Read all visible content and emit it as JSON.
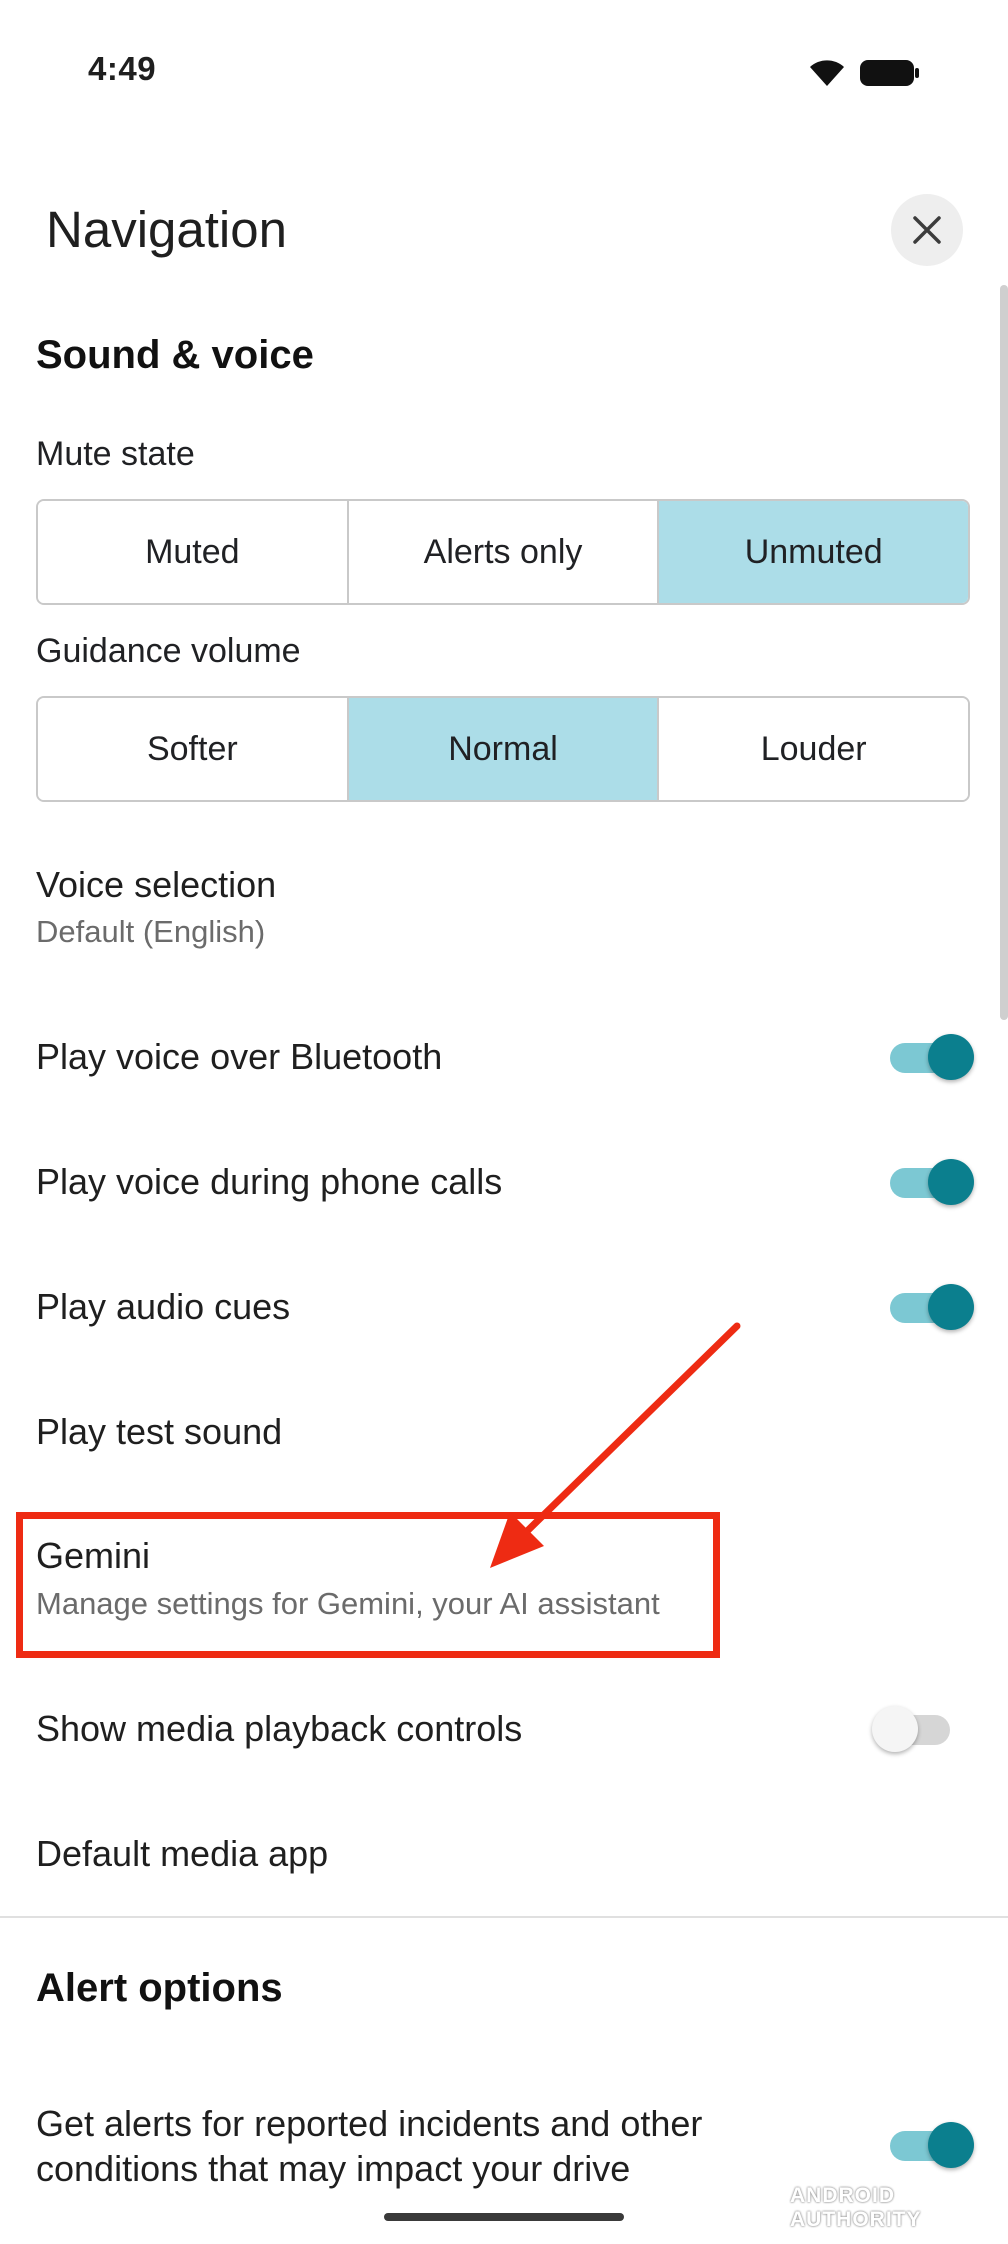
{
  "status_bar": {
    "time": "4:49"
  },
  "header": {
    "title": "Navigation"
  },
  "sound_voice": {
    "heading": "Sound & voice",
    "mute_state": {
      "label": "Mute state",
      "options": [
        "Muted",
        "Alerts only",
        "Unmuted"
      ],
      "selected": "Unmuted"
    },
    "guidance_volume": {
      "label": "Guidance volume",
      "options": [
        "Softer",
        "Normal",
        "Louder"
      ],
      "selected": "Normal"
    },
    "voice_selection": {
      "title": "Voice selection",
      "value": "Default (English)"
    },
    "rows": [
      {
        "title": "Play voice over Bluetooth",
        "toggle": true
      },
      {
        "title": "Play voice during phone calls",
        "toggle": true
      },
      {
        "title": "Play audio cues",
        "toggle": true
      }
    ],
    "play_test_sound": "Play test sound",
    "gemini": {
      "title": "Gemini",
      "subtitle": "Manage settings for Gemini, your AI assistant"
    },
    "media_controls": {
      "title": "Show media playback controls",
      "toggle": false
    },
    "default_media_app": "Default media app"
  },
  "alert_options": {
    "heading": "Alert options",
    "incidents": {
      "line1": "Get alerts for reported incidents and other",
      "line2": "conditions that may impact your drive",
      "toggle": true
    }
  },
  "watermark": "ANDROID AUTHORITY",
  "colors": {
    "selected_segment": "#acdde8",
    "toggle_on": "#0b7f8e",
    "annotation_red": "#ee2b13"
  }
}
